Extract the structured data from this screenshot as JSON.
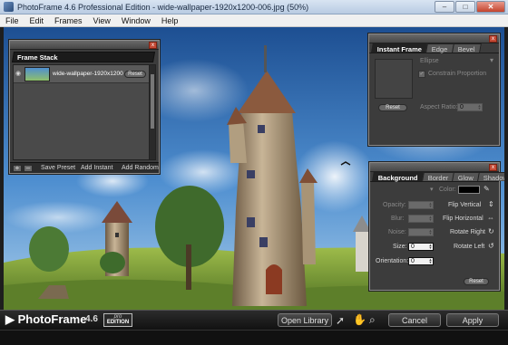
{
  "window": {
    "title": "PhotoFrame 4.6 Professional Edition - wide-wallpaper-1920x1200-006.jpg (50%)",
    "minimize": "–",
    "maximize": "□",
    "close": "✕"
  },
  "menu": [
    "File",
    "Edit",
    "Frames",
    "View",
    "Window",
    "Help"
  ],
  "frame_stack": {
    "title": "Frame Stack",
    "item_name": "wide-wallpaper-1920x1200",
    "item_badge": "Reset",
    "add_icon": "+",
    "remove_icon": "–",
    "save_preset": "Save Preset",
    "add_instant": "Add Instant",
    "add_random": "Add Random"
  },
  "instant_frame": {
    "tabs": [
      "Instant Frame",
      "Edge",
      "Bevel"
    ],
    "ellipse": "Ellipse",
    "constrain": "Constrain Proportion",
    "constrain_checked": true,
    "reset": "Reset",
    "aspect_label": "Aspect Ratio:",
    "aspect_value": "0"
  },
  "background": {
    "tabs": [
      "Background",
      "Border",
      "Glow",
      "Shadow"
    ],
    "color_label": "Color:",
    "color_value": "#000000",
    "opacity_label": "Opacity:",
    "blur_label": "Blur:",
    "noise_label": "Noise:",
    "size_label": "Size:",
    "size_value": "0",
    "orientation_label": "Orientation:",
    "orientation_value": "0",
    "flip_vertical": "Flip Vertical",
    "flip_horizontal": "Flip Horizontal",
    "rotate_right": "Rotate Right",
    "rotate_left": "Rotate Left",
    "reset": "Reset"
  },
  "bottom": {
    "logo": "PhotoFrame",
    "version": "4.6",
    "edition_line1": "pro",
    "edition_line2": "EDITION",
    "open_library": "Open Library",
    "cancel": "Cancel",
    "apply": "Apply"
  },
  "icons": {
    "eye": "eye-icon",
    "arrow_tool": "arrow-select-icon",
    "hand_tool": "hand-icon",
    "zoom_tool": "zoom-icon"
  },
  "colors": {
    "sky": "#2f6fb5",
    "grass": "#7aa13a",
    "panel": "#3c3c3c",
    "close": "#c44a36"
  }
}
